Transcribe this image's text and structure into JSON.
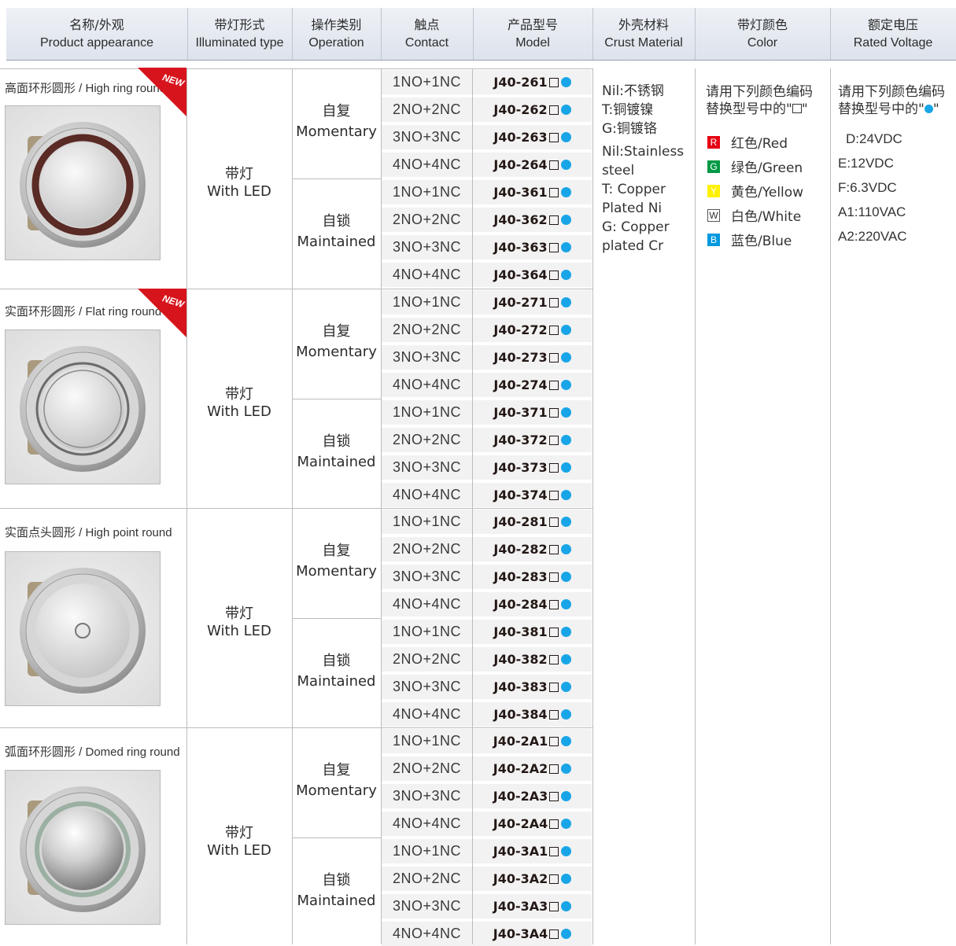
{
  "header": [
    {
      "zh": "名称/外观",
      "en": "Product appearance"
    },
    {
      "zh": "带灯形式",
      "en": "Illuminated type"
    },
    {
      "zh": "操作类别",
      "en": "Operation"
    },
    {
      "zh": "触点",
      "en": "Contact"
    },
    {
      "zh": "产品型号",
      "en": "Model"
    },
    {
      "zh": "外壳材料",
      "en": "Crust Material"
    },
    {
      "zh": "带灯颜色",
      "en": "Color"
    },
    {
      "zh": "额定电压",
      "en": "Rated Voltage"
    }
  ],
  "new_badge": "NEW",
  "groups": [
    {
      "title": "高面环形圆形 / High ring round",
      "new": true,
      "illum_zh": "带灯",
      "illum_en": "With LED",
      "operations": [
        {
          "zh": "自复",
          "en": "Momentary",
          "rows": [
            {
              "contact": "1NO+1NC",
              "model": "J40-261"
            },
            {
              "contact": "2NO+2NC",
              "model": "J40-262"
            },
            {
              "contact": "3NO+3NC",
              "model": "J40-263"
            },
            {
              "contact": "4NO+4NC",
              "model": "J40-264"
            }
          ]
        },
        {
          "zh": "自锁",
          "en": "Maintained",
          "rows": [
            {
              "contact": "1NO+1NC",
              "model": "J40-361"
            },
            {
              "contact": "2NO+2NC",
              "model": "J40-362"
            },
            {
              "contact": "3NO+3NC",
              "model": "J40-363"
            },
            {
              "contact": "4NO+4NC",
              "model": "J40-364"
            }
          ]
        }
      ]
    },
    {
      "title": "实面环形圆形 / Flat ring round",
      "new": true,
      "illum_zh": "带灯",
      "illum_en": "With LED",
      "operations": [
        {
          "zh": "自复",
          "en": "Momentary",
          "rows": [
            {
              "contact": "1NO+1NC",
              "model": "J40-271"
            },
            {
              "contact": "2NO+2NC",
              "model": "J40-272"
            },
            {
              "contact": "3NO+3NC",
              "model": "J40-273"
            },
            {
              "contact": "4NO+4NC",
              "model": "J40-274"
            }
          ]
        },
        {
          "zh": "自锁",
          "en": "Maintained",
          "rows": [
            {
              "contact": "1NO+1NC",
              "model": "J40-371"
            },
            {
              "contact": "2NO+2NC",
              "model": "J40-372"
            },
            {
              "contact": "3NO+3NC",
              "model": "J40-373"
            },
            {
              "contact": "4NO+4NC",
              "model": "J40-374"
            }
          ]
        }
      ]
    },
    {
      "title": "实面点头圆形 / High point round",
      "new": false,
      "illum_zh": "带灯",
      "illum_en": "With LED",
      "operations": [
        {
          "zh": "自复",
          "en": "Momentary",
          "rows": [
            {
              "contact": "1NO+1NC",
              "model": "J40-281"
            },
            {
              "contact": "2NO+2NC",
              "model": "J40-282"
            },
            {
              "contact": "3NO+3NC",
              "model": "J40-283"
            },
            {
              "contact": "4NO+4NC",
              "model": "J40-284"
            }
          ]
        },
        {
          "zh": "自锁",
          "en": "Maintained",
          "rows": [
            {
              "contact": "1NO+1NC",
              "model": "J40-381"
            },
            {
              "contact": "2NO+2NC",
              "model": "J40-382"
            },
            {
              "contact": "3NO+3NC",
              "model": "J40-383"
            },
            {
              "contact": "4NO+4NC",
              "model": "J40-384"
            }
          ]
        }
      ]
    },
    {
      "title": "弧面环形圆形 / Domed ring round",
      "new": false,
      "illum_zh": "带灯",
      "illum_en": "With LED",
      "operations": [
        {
          "zh": "自复",
          "en": "Momentary",
          "rows": [
            {
              "contact": "1NO+1NC",
              "model": "J40-2A1"
            },
            {
              "contact": "2NO+2NC",
              "model": "J40-2A2"
            },
            {
              "contact": "3NO+3NC",
              "model": "J40-2A3"
            },
            {
              "contact": "4NO+4NC",
              "model": "J40-2A4"
            }
          ]
        },
        {
          "zh": "自锁",
          "en": "Maintained",
          "rows": [
            {
              "contact": "1NO+1NC",
              "model": "J40-3A1"
            },
            {
              "contact": "2NO+2NC",
              "model": "J40-3A2"
            },
            {
              "contact": "3NO+3NC",
              "model": "J40-3A3"
            },
            {
              "contact": "4NO+4NC",
              "model": "J40-3A4"
            }
          ]
        }
      ]
    }
  ],
  "material_lines": [
    "Nil:不锈钢",
    "T:铜镀镍",
    "G:铜镀铬",
    "Nil:Stainless",
    "steel",
    "T: Copper",
    "Plated Ni",
    "G: Copper",
    "plated Cr"
  ],
  "color_intro_line1": "请用下列颜色编码",
  "color_intro_line2_a": "替换型号中的\"",
  "color_intro_line2_b": "\"",
  "colors": [
    {
      "code": "R",
      "label": "红色/Red",
      "hex": "#e60012",
      "text": "#ffffff"
    },
    {
      "code": "G",
      "label": "绿色/Green",
      "hex": "#009944",
      "text": "#ffffff"
    },
    {
      "code": "Y",
      "label": "黄色/Yellow",
      "hex": "#fff100",
      "text": "#ffffff"
    },
    {
      "code": "W",
      "label": "白色/White",
      "hex": "#ffffff",
      "text": "#333333"
    },
    {
      "code": "B",
      "label": "蓝色/Blue",
      "hex": "#0099e0",
      "text": "#ffffff"
    }
  ],
  "volt_intro_line1": "请用下列颜色编码",
  "volt_intro_line2_a": "替换型号中的\"",
  "volt_intro_line2_b": "\"",
  "voltages": [
    "D:24VDC",
    "E:12VDC",
    "F:6.3VDC",
    "A1:110VAC",
    "A2:220VAC"
  ],
  "accent": {
    "dot": "#18a5e8",
    "badge": "#d7141c"
  }
}
